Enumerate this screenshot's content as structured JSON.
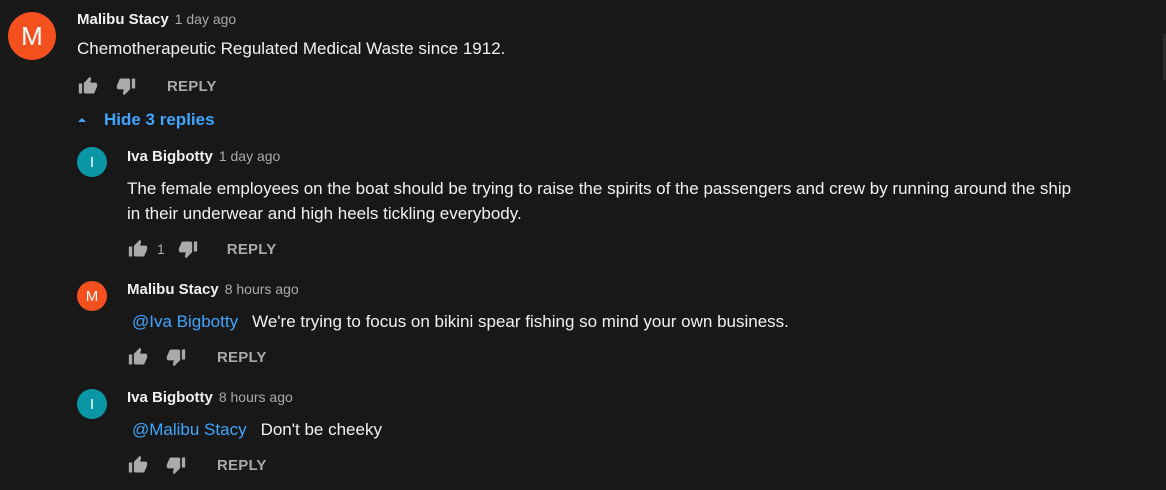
{
  "comment": {
    "avatar_letter": "M",
    "author": "Malibu Stacy",
    "time": "1 day ago",
    "text": "Chemotherapeutic Regulated Medical Waste since 1912.",
    "reply_label": "REPLY"
  },
  "replies_toggle": {
    "label": "Hide 3 replies",
    "icon": "caret-up-icon"
  },
  "replies": [
    {
      "avatar_letter": "I",
      "author": "Iva Bigbotty",
      "time": "1 day ago",
      "text_line1": "The female employees on the boat should be trying to raise the spirits of the passengers and crew by running around the ship",
      "text_line2": "in their underwear and high heels tickling everybody.",
      "likes": "1",
      "reply_label": "REPLY"
    },
    {
      "avatar_letter": "M",
      "author": "Malibu Stacy",
      "time": "8 hours ago",
      "mention": "@Iva Bigbotty",
      "text": "We're trying to focus on bikini spear fishing so mind your own business.",
      "reply_label": "REPLY"
    },
    {
      "avatar_letter": "I",
      "author": "Iva Bigbotty",
      "time": "8 hours ago",
      "mention": "@Malibu Stacy",
      "text": "Don't be cheeky",
      "reply_label": "REPLY"
    }
  ],
  "colors": {
    "background": "#181818",
    "link": "#3ea6ff",
    "avatar_orange": "#f4511e",
    "avatar_teal": "#0b96a6",
    "secondary_text": "#aaaaaa"
  }
}
